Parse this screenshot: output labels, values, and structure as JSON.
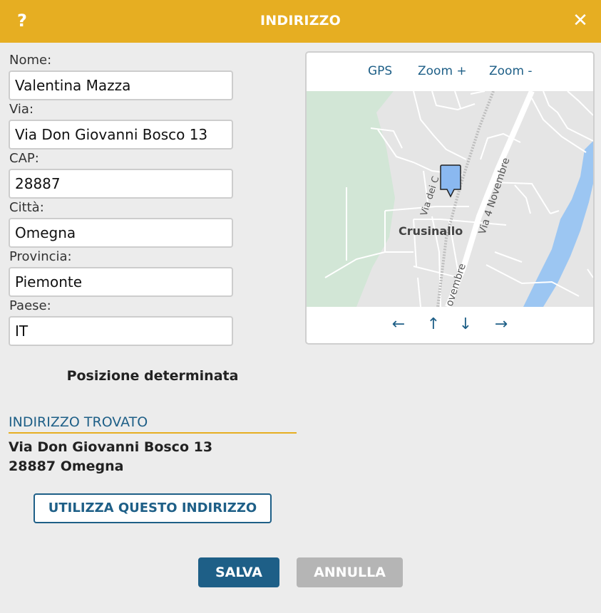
{
  "header": {
    "help_label": "?",
    "title": "INDIRIZZO",
    "close_label": "✕"
  },
  "form": {
    "name_label": "Nome:",
    "name_value": "Valentina Mazza",
    "street_label": "Via:",
    "street_value": "Via Don Giovanni Bosco 13",
    "zip_label": "CAP:",
    "zip_value": "28887",
    "city_label": "Città:",
    "city_value": "Omegna",
    "province_label": "Provincia:",
    "province_value": "Piemonte",
    "country_label": "Paese:",
    "country_value": "IT"
  },
  "map": {
    "gps_label": "GPS",
    "zoom_in_label": "Zoom +",
    "zoom_out_label": "Zoom -",
    "place_label": "Crusinallo",
    "road_label_1": "Via 4 Novembre",
    "road_label_2": "Via dei C",
    "road_label_3": "ovembre",
    "arrow_left": "←",
    "arrow_up": "↑",
    "arrow_down": "↓",
    "arrow_right": "→",
    "colors": {
      "land": "#e5e5e5",
      "park": "#d2e6d6",
      "water": "#9cc6f2",
      "road": "#ffffff",
      "railway": "#bdbdbd",
      "pin": "#8ab8f0"
    }
  },
  "status": {
    "position_text": "Posizione determinata"
  },
  "found": {
    "heading": "INDIRIZZO TROVATO",
    "line1": "Via Don Giovanni Bosco 13",
    "line2": "28887 Omegna"
  },
  "actions": {
    "use_address": "UTILIZZA QUESTO INDIRIZZO",
    "save": "SALVA",
    "cancel": "ANNULLA"
  },
  "colors": {
    "header": "#e6ae22",
    "accent": "#1e5f87",
    "background": "#ececec",
    "disabled": "#b5b5b5"
  }
}
